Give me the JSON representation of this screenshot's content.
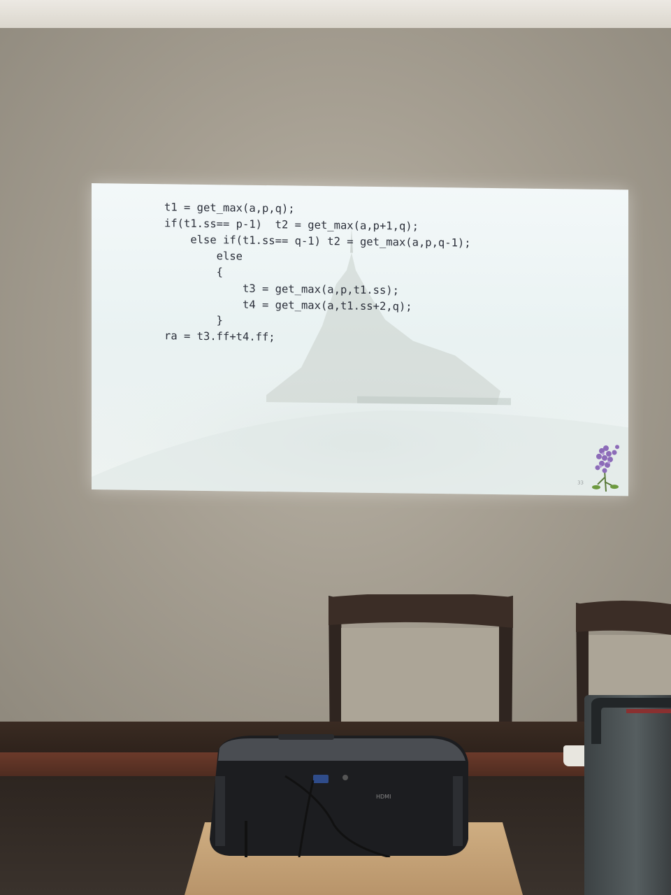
{
  "slide": {
    "code_lines": [
      "t1 = get_max(a,p,q);",
      "if(t1.ss== p-1)  t2 = get_max(a,p+1,q);",
      "    else if(t1.ss== q-1) t2 = get_max(a,p,q-1);",
      "        else",
      "        {",
      "            t3 = get_max(a,p,t1.ss);",
      "            t4 = get_max(a,t1.ss+2,q);",
      "        }",
      "ra = t3.ff+t4.ff;"
    ],
    "page_number": "33"
  },
  "colors": {
    "slide_background": "#eef5f5",
    "code_text": "#2b2f3a",
    "code_highlight": "#b83a4a",
    "wall": "#a69f92"
  }
}
